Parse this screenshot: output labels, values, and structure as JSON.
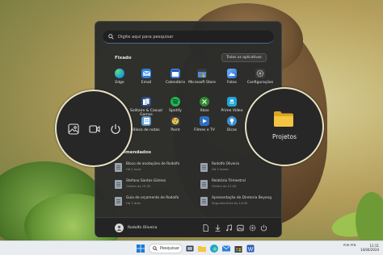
{
  "start_menu": {
    "search_placeholder": "Digite aqui para pesquisar",
    "pinned_title": "Fixado",
    "all_apps_label": "Todos os aplicativos",
    "pinned_apps": [
      {
        "label": "Edge",
        "icon": "edge-icon",
        "color": "#1fa1d8"
      },
      {
        "label": "Email",
        "icon": "mail-icon",
        "color": "#2a7fd6"
      },
      {
        "label": "Calendário",
        "icon": "calendar-icon",
        "color": "#3b7bd8"
      },
      {
        "label": "Microsoft Store",
        "icon": "store-icon",
        "color": "#4a8be0"
      },
      {
        "label": "Fotos",
        "icon": "photos-icon",
        "color": "#4a90d9"
      },
      {
        "label": "Configurações",
        "icon": "gear-icon",
        "color": "#8a8a8a"
      },
      {
        "label": "Solitaire & Casual Games",
        "icon": "solitaire-icon",
        "color": "#2a4f8a"
      },
      {
        "label": "Spotify",
        "icon": "spotify-icon",
        "color": "#1db954"
      },
      {
        "label": "Xbox",
        "icon": "xbox-icon",
        "color": "#2f8a2f"
      },
      {
        "label": "Prime Video",
        "icon": "prime-video-icon",
        "color": "#1fa6d8"
      },
      {
        "label": "Bloco de notas",
        "icon": "notepad-icon",
        "color": "#5d9ed1"
      },
      {
        "label": "Paint",
        "icon": "paint-icon",
        "color": "#e6b532"
      },
      {
        "label": "Filmes e TV",
        "icon": "films-icon",
        "color": "#2f6fc0"
      },
      {
        "label": "Dicas",
        "icon": "tips-icon",
        "color": "#3b8fd4"
      }
    ],
    "recommended_title": "Recomendados",
    "recommended": [
      {
        "name": "Bloco de anotações de Rodolfo",
        "time": "Há 1 hora"
      },
      {
        "name": "Rodolfo Oliveira",
        "time": "Há 2 horas"
      },
      {
        "name": "Stefano Santos Gómez",
        "time": "Ontem às 15:32"
      },
      {
        "name": "Relatório Trimestral",
        "time": "Ontem às 12:50"
      },
      {
        "name": "Guia de orçamento de Rodolfo",
        "time": "Há 3 dias"
      },
      {
        "name": "Apresentação de Diretoria Beyong",
        "time": "Segunda-feira às 14:05"
      }
    ],
    "user_name": "Rodolfo Oliveira"
  },
  "left_magnifier": {
    "icons": [
      "image-icon",
      "video-icon",
      "power-icon"
    ]
  },
  "right_magnifier": {
    "folder_label": "Projetos",
    "folder_color": "#f4c542"
  },
  "taskbar": {
    "search_label": "Pesquisar",
    "tray_language": "POR PTB",
    "tray_time": "11:11",
    "tray_date": "14/04/2024"
  }
}
